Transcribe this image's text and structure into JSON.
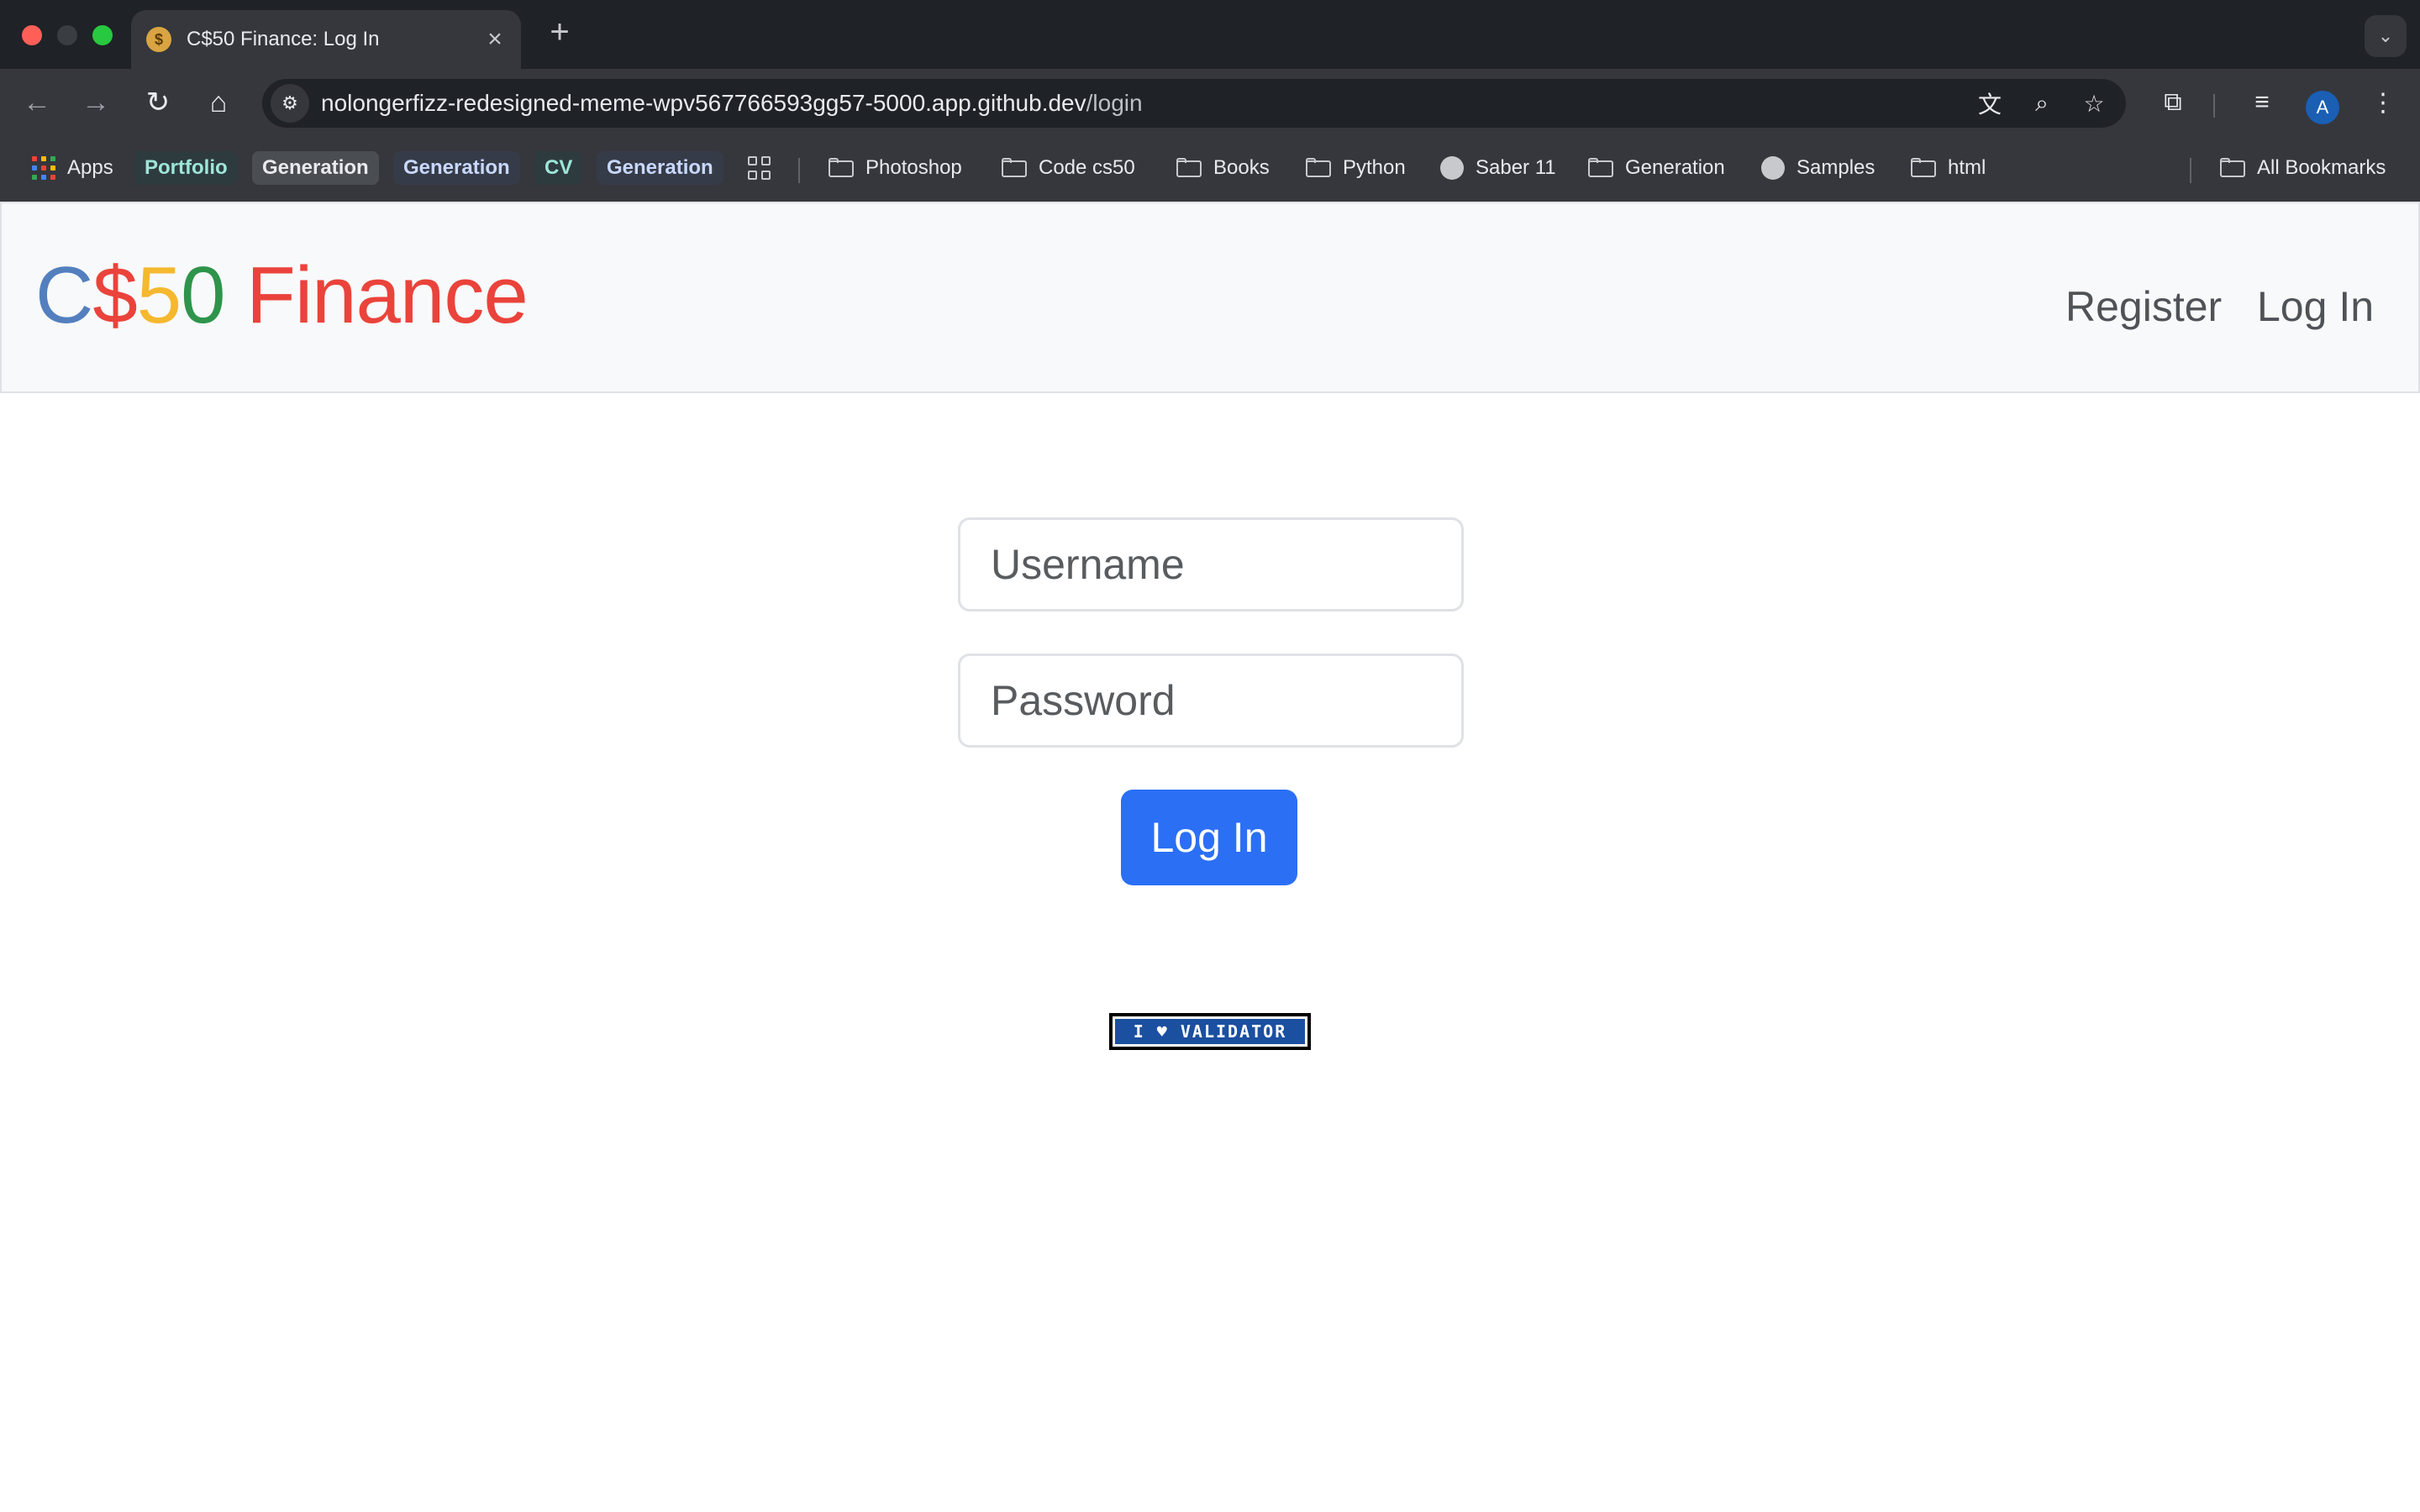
{
  "browser": {
    "tab": {
      "title": "C$50 Finance: Log In",
      "favicon": "$",
      "close": "×"
    },
    "new_tab": "+",
    "tab_search": "⌄",
    "nav": {
      "back": "←",
      "forward": "→",
      "reload": "↻",
      "home": "⌂"
    },
    "site_info": "⚙",
    "url": {
      "host": "nolongerfizz-redesigned-meme-wpv567766593gg57-5000.app.github.dev",
      "path": "/login"
    },
    "omnibox_icons": {
      "translate": "文",
      "zoom": "⌕",
      "bookmark": "☆"
    },
    "toolbar_icons": {
      "extensions": "⧉",
      "media": "≡",
      "menu": "⋮"
    },
    "profile_initial": "A"
  },
  "bookmarks": {
    "apps": "Apps",
    "items": [
      {
        "label": "Portfolio",
        "chip_bg": "#2e3b3e",
        "chip_color": "#9ee6d8"
      },
      {
        "label": "Generation",
        "chip_bg": "#4a4d52",
        "chip_color": "#e8eaed"
      },
      {
        "label": "Generation",
        "chip_bg": "#363b48",
        "chip_color": "#c8d8ff"
      },
      {
        "label": "CV",
        "chip_bg": "#2e3b3e",
        "chip_color": "#9ee6d8"
      },
      {
        "label": "Generation",
        "chip_bg": "#363b48",
        "chip_color": "#c8d8ff"
      }
    ],
    "folders": [
      "Photoshop",
      "Code cs50",
      "Books",
      "Python",
      "Saber 11",
      "Generation",
      "Samples",
      "html"
    ],
    "all": "All Bookmarks"
  },
  "page": {
    "brand": {
      "c": "C",
      "dollar": "$",
      "five": "5",
      "zero": "0",
      "finance": " Finance"
    },
    "nav": {
      "register": "Register",
      "login": "Log In"
    },
    "form": {
      "username_placeholder": "Username",
      "password_placeholder": "Password",
      "submit": "Log In"
    },
    "validator_badge": "I ♥ VALIDATOR"
  },
  "colors": {
    "brand_blue": "#537fbe",
    "brand_red": "#ea433b",
    "brand_yellow": "#f5b82e",
    "brand_green": "#2e944b",
    "primary_button": "#2b6ff5"
  }
}
